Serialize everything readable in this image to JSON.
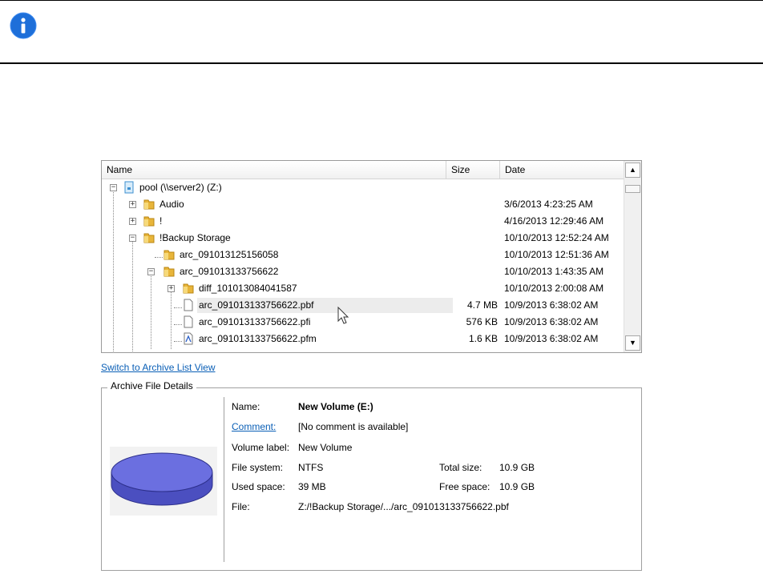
{
  "tree": {
    "columns": {
      "name": "Name",
      "size": "Size",
      "date": "Date"
    },
    "rows": [
      {
        "name": "pool (\\\\server2) (Z:)",
        "size": "",
        "date": ""
      },
      {
        "name": "Audio",
        "size": "",
        "date": "3/6/2013 4:23:25 AM"
      },
      {
        "name": "!",
        "size": "",
        "date": "4/16/2013 12:29:46 AM"
      },
      {
        "name": "!Backup Storage",
        "size": "",
        "date": "10/10/2013 12:52:24 AM"
      },
      {
        "name": "arc_091013125156058",
        "size": "",
        "date": "10/10/2013 12:51:36 AM"
      },
      {
        "name": "arc_091013133756622",
        "size": "",
        "date": "10/10/2013 1:43:35 AM"
      },
      {
        "name": "diff_101013084041587",
        "size": "",
        "date": "10/10/2013 2:00:08 AM"
      },
      {
        "name": "arc_091013133756622.pbf",
        "size": "4.7 MB",
        "date": "10/9/2013 6:38:02 AM"
      },
      {
        "name": "arc_091013133756622.pfi",
        "size": "576 KB",
        "date": "10/9/2013 6:38:02 AM"
      },
      {
        "name": "arc_091013133756622.pfm",
        "size": "1.6 KB",
        "date": "10/9/2013 6:38:02 AM"
      }
    ],
    "expander_plus": "+",
    "expander_minus": "−",
    "scroll_up": "▲",
    "scroll_down": "▼"
  },
  "switch_link": "Switch to Archive List View",
  "details": {
    "group_label": "Archive File Details",
    "name_label": "Name:",
    "name_value": "New Volume (E:)",
    "comment_label": "Comment:",
    "comment_value": "[No comment is available]",
    "volume_label_label": "Volume label:",
    "volume_label_value": "New Volume",
    "file_system_label": "File system:",
    "file_system_value": "NTFS",
    "used_space_label": "Used space:",
    "used_space_value": "39 MB",
    "file_label": "File:",
    "file_value": "Z:/!Backup Storage/.../arc_091013133756622.pbf",
    "total_size_label": "Total size:",
    "total_size_value": "10.9 GB",
    "free_space_label": "Free space:",
    "free_space_value": "10.9 GB"
  },
  "colors": {
    "link": "#0a5fb6",
    "info_icon": "#1e6fd9",
    "disk": "#6b6fe0",
    "folder": "#e8b53a"
  }
}
